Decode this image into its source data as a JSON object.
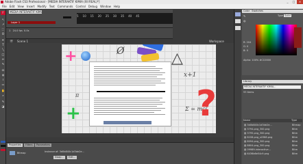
{
  "window": {
    "title": "Adobe Flash CS3 Professional - [MEDIA INTERAKTIF KIMIA (XII REAL)*]",
    "minimize": "_",
    "maximize": "□",
    "close": "×"
  },
  "menu": [
    "File",
    "Edit",
    "View",
    "Insert",
    "Modify",
    "Text",
    "Commands",
    "Control",
    "Debug",
    "Window",
    "Help"
  ],
  "document_tab": "MEDIA INTERAKTIF KIMIA (XII REAL)*",
  "timeline": {
    "layer_name": "Layer 1",
    "frame_label": "1",
    "fps": "24.0 fps",
    "time": "0.0s",
    "frame_numbers": [
      "5",
      "10",
      "15",
      "20",
      "25",
      "30",
      "35",
      "40",
      "45"
    ]
  },
  "scene": {
    "label": "Scene 1",
    "workspace": "Workspace"
  },
  "properties": {
    "tabs": [
      "Color",
      "Swatches"
    ],
    "type_label": "Type",
    "type_value": "Solid",
    "r": "204",
    "g": "0",
    "b": "0",
    "alpha": "100%",
    "hex": "#CC0000"
  },
  "library": {
    "tab": "Library",
    "document": "MEDIA INTERAKTIF KIMIA...",
    "count": "93 items",
    "col_name": "Name",
    "col_type": "Type",
    "items": [
      {
        "name": "3d0b840c1d3de2e...",
        "type": "Bitmap"
      },
      {
        "name": "3794.png_300.png",
        "type": "Bitm"
      },
      {
        "name": "3795.png_300.png",
        "type": "Bitm"
      },
      {
        "name": "8208.png_s0388.png",
        "type": "Bitm"
      },
      {
        "name": "8094.png_300.png",
        "type": "Bitm"
      },
      {
        "name": "8804.png_300.png",
        "type": "Bitm"
      },
      {
        "name": "09989-interactive...",
        "type": "Bitm"
      },
      {
        "name": "6436b6e54c9.png",
        "type": "Bitm"
      }
    ]
  },
  "bottom": {
    "tabs": [
      "Properties",
      "Filters",
      "Parameters"
    ],
    "kind": "Bitmap",
    "instance_label": "Instance of:",
    "instance_value": "3d0b840c1d3de2e...",
    "swap_label": "Swap...",
    "edit_label": "Edit..."
  },
  "colors": {
    "accent_red": "#8c0d0d",
    "stage_bg": "#ececec",
    "panel_bg": "#4a4a4a"
  }
}
